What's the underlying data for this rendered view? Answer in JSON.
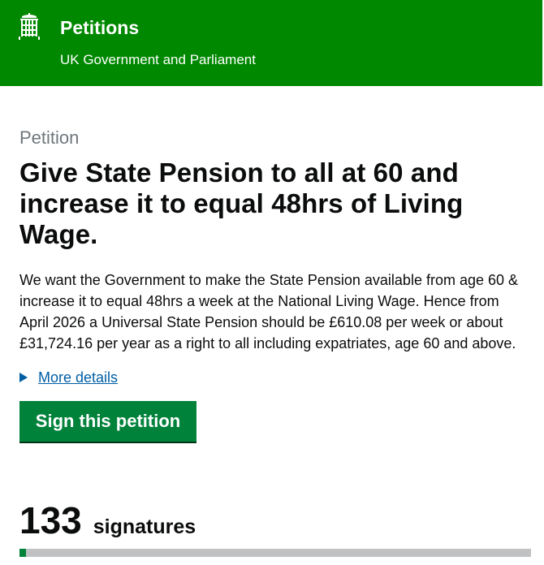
{
  "header": {
    "title": "Petitions",
    "subtitle": "UK Government and Parliament",
    "logo_icon": "portcullis-icon",
    "background_color": "#008800"
  },
  "petition": {
    "caption": "Petition",
    "title": "Give State Pension to all at 60 and increase it to equal 48hrs of Living Wage.",
    "body": "We want the Government to make the State Pension available from age 60 & increase it to equal 48hrs a week at the National Living Wage. Hence from April 2026 a Universal State Pension should be £610.08 per week or about £31,724.16 per year as a right to all including expatriates, age 60 and above.",
    "details_label": "More details",
    "details_icon": "triangle-right-icon",
    "sign_button_label": "Sign this petition",
    "button_color": "#00823b"
  },
  "signatures": {
    "count": "133",
    "label": "signatures",
    "progress_fraction": 0.013
  }
}
